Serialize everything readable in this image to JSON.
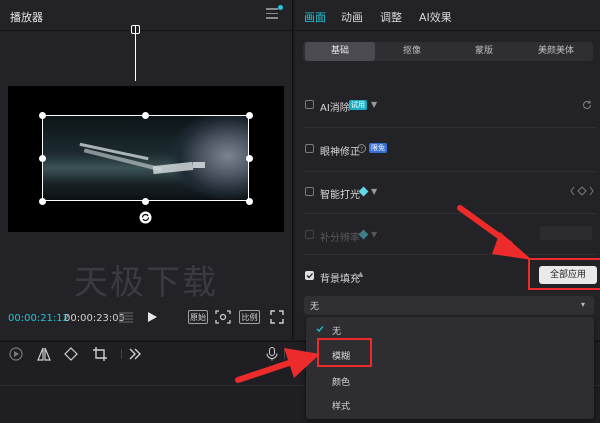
{
  "player": {
    "title": "播放器",
    "watermark": "天极下载",
    "time_current": "00:00:21:12",
    "time_total": "00:00:23:05",
    "btn_ratio_a": "原始",
    "btn_ratio_b": "比例"
  },
  "props": {
    "tabs": [
      "画面",
      "动画",
      "调整",
      "AI效果"
    ],
    "active_tab": "画面",
    "subtabs": [
      "基础",
      "抠像",
      "蒙版",
      "美颜美体"
    ],
    "active_subtab": "基础",
    "rows": {
      "ai_remove": {
        "label": "AI消除",
        "badge": "试用"
      },
      "eye_fix": {
        "label": "眼神修正",
        "badge": "限免"
      },
      "smart_light": {
        "label": "智能打光"
      },
      "super_res": {
        "label": "补分辨率"
      },
      "bg_fill": {
        "label": "背景填充"
      }
    },
    "apply_all": "全部应用",
    "bg_fill_value": "无",
    "dropdown_options": [
      "无",
      "模糊",
      "颜色",
      "样式"
    ],
    "dropdown_selected": "无",
    "dropdown_highlight": "模糊"
  },
  "colors": {
    "accent": "#20c7d8",
    "highlight_red": "#ee2b2b"
  }
}
